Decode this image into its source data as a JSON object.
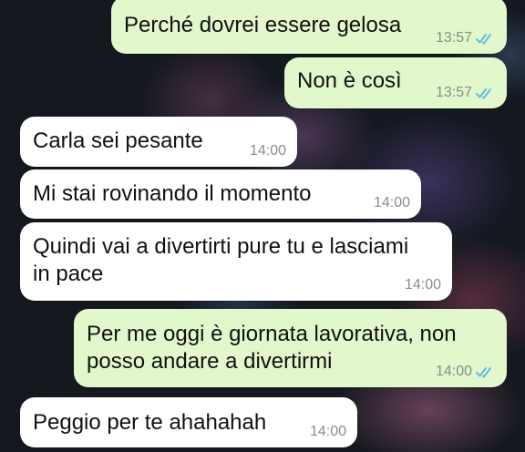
{
  "messages": [
    {
      "direction": "out",
      "text_lines": [
        "Perché dovrei essere gelosa"
      ],
      "time": "13:57",
      "status": "read"
    },
    {
      "direction": "out",
      "text_lines": [
        "Non è così"
      ],
      "time": "13:57",
      "status": "read"
    },
    {
      "direction": "in",
      "text_lines": [
        "Carla sei pesante"
      ],
      "time": "14:00"
    },
    {
      "direction": "in",
      "text_lines": [
        "Mi stai rovinando il momento"
      ],
      "time": "14:00"
    },
    {
      "direction": "in",
      "text_lines": [
        "Quindi vai a divertirti pure tu e lasciami",
        "in pace"
      ],
      "time": "14:00"
    },
    {
      "direction": "out",
      "text_lines": [
        "Per me oggi è giornata lavorativa, non",
        "posso andare a divertirmi"
      ],
      "time": "14:00",
      "status": "read"
    },
    {
      "direction": "in",
      "text_lines": [
        "Peggio per te ahahahah"
      ],
      "time": "14:00"
    }
  ],
  "colors": {
    "outgoing_bubble": "#e2f7cb",
    "incoming_bubble": "#ffffff",
    "read_ticks": "#4fb6ec",
    "timestamp": "#8c8c8c"
  },
  "icons": {
    "read_receipt": "double-check-icon"
  }
}
